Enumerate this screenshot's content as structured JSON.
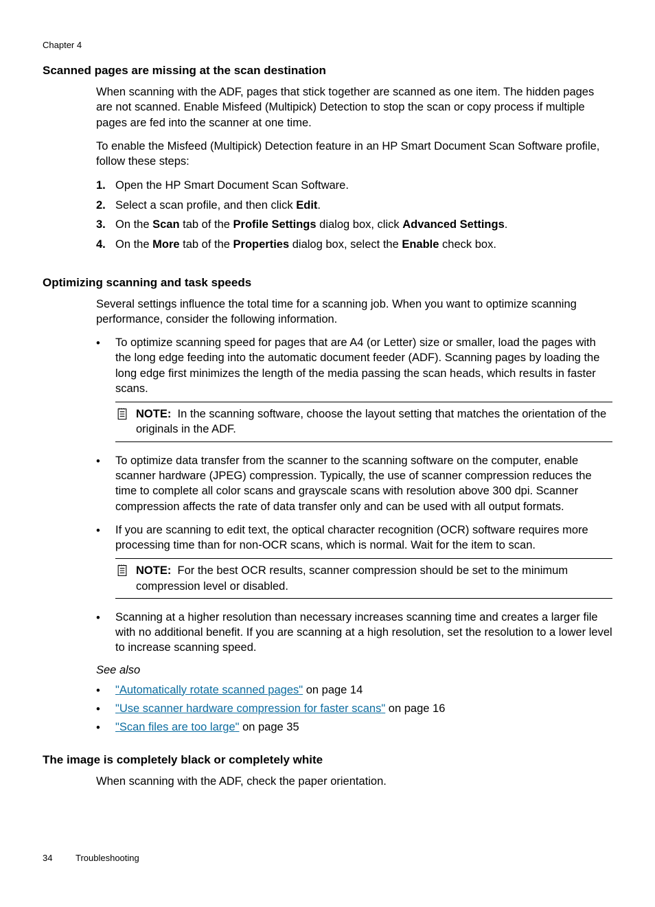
{
  "header": {
    "chapter": "Chapter 4"
  },
  "section1": {
    "heading": "Scanned pages are missing at the scan destination",
    "p1": "When scanning with the ADF, pages that stick together are scanned as one item. The hidden pages are not scanned. Enable Misfeed (Multipick) Detection to stop the scan or copy process if multiple pages are fed into the scanner at one time.",
    "p2": "To enable the Misfeed (Multipick) Detection feature in an HP Smart Document Scan Software profile, follow these steps:",
    "steps": {
      "n1": "1.",
      "t1": "Open the HP Smart Document Scan Software.",
      "n2": "2.",
      "t2a": "Select a scan profile, and then click ",
      "t2b": "Edit",
      "t2c": ".",
      "n3": "3.",
      "t3a": "On the ",
      "t3b": "Scan",
      "t3c": " tab of the ",
      "t3d": "Profile Settings",
      "t3e": " dialog box, click ",
      "t3f": "Advanced Settings",
      "t3g": ".",
      "n4": "4.",
      "t4a": "On the ",
      "t4b": "More",
      "t4c": " tab of the ",
      "t4d": "Properties",
      "t4e": " dialog box, select the ",
      "t4f": "Enable",
      "t4g": " check box."
    }
  },
  "section2": {
    "heading": "Optimizing scanning and task speeds",
    "p1": "Several settings influence the total time for a scanning job. When you want to optimize scanning performance, consider the following information.",
    "b1": "To optimize scanning speed for pages that are A4 (or Letter) size or smaller, load the pages with the long edge feeding into the automatic document feeder (ADF). Scanning pages by loading the long edge first minimizes the length of the media passing the scan heads, which results in faster scans.",
    "note1_label": "NOTE:",
    "note1_text": "In the scanning software, choose the layout setting that matches the orientation of the originals in the ADF.",
    "b2": "To optimize data transfer from the scanner to the scanning software on the computer, enable scanner hardware (JPEG) compression. Typically, the use of scanner compression reduces the time to complete all color scans and grayscale scans with resolution above 300 dpi. Scanner compression affects the rate of data transfer only and can be used with all output formats.",
    "b3": "If you are scanning to edit text, the optical character recognition (OCR) software requires more processing time than for non-OCR scans, which is normal. Wait for the item to scan.",
    "note2_label": "NOTE:",
    "note2_text": "For the best OCR results, scanner compression should be set to the minimum compression level or disabled.",
    "b4": "Scanning at a higher resolution than necessary increases scanning time and creates a larger file with no additional benefit. If you are scanning at a high resolution, set the resolution to a lower level to increase scanning speed.",
    "see_also": "See also",
    "link1_q1": "\"",
    "link1_text": "Automatically rotate scanned pages",
    "link1_q2": "\"",
    "link1_tail": " on page 14",
    "link2_q1": "\"",
    "link2_text": "Use scanner hardware compression for faster scans",
    "link2_q2": "\"",
    "link2_tail": " on page 16",
    "link3_q1": "\"",
    "link3_text": "Scan files are too large",
    "link3_q2": "\"",
    "link3_tail": " on page 35"
  },
  "section3": {
    "heading": "The image is completely black or completely white",
    "p1": "When scanning with the ADF, check the paper orientation."
  },
  "footer": {
    "page": "34",
    "section": "Troubleshooting"
  },
  "glyphs": {
    "bullet": "•"
  }
}
